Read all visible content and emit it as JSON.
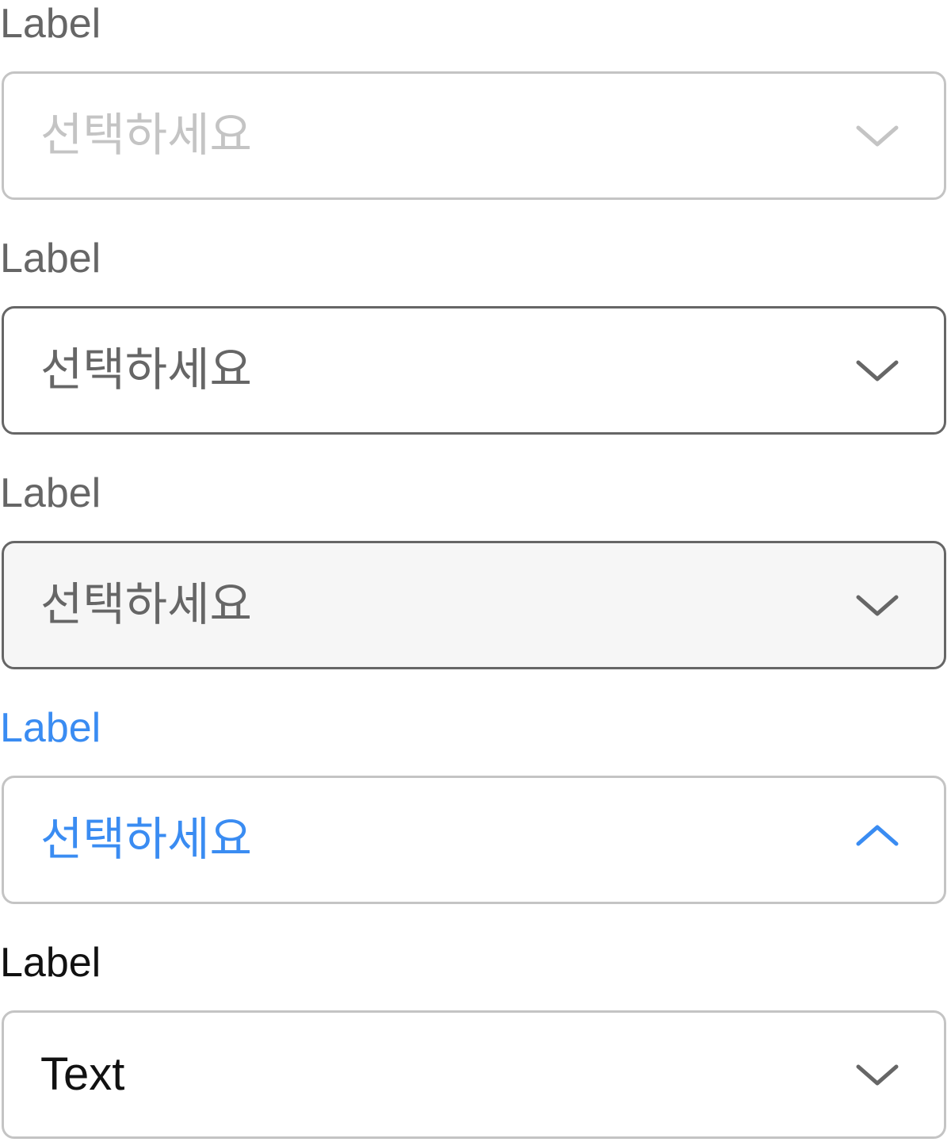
{
  "colors": {
    "label_default": "#666666",
    "label_active": "#3a8cf2",
    "label_filled": "#111111",
    "border_default": "#c4c4c4",
    "border_hover": "#666666",
    "placeholder_disabled": "#c4c4c4",
    "pressed_background": "#f6f6f6",
    "accent": "#3a8cf2"
  },
  "fields": [
    {
      "label": "Label",
      "value": "선택하세요",
      "icon": "chevron-down-icon"
    },
    {
      "label": "Label",
      "value": "선택하세요",
      "icon": "chevron-down-icon"
    },
    {
      "label": "Label",
      "value": "선택하세요",
      "icon": "chevron-down-icon"
    },
    {
      "label": "Label",
      "value": "선택하세요",
      "icon": "chevron-up-icon"
    },
    {
      "label": "Label",
      "value": "Text",
      "icon": "chevron-down-icon"
    }
  ]
}
